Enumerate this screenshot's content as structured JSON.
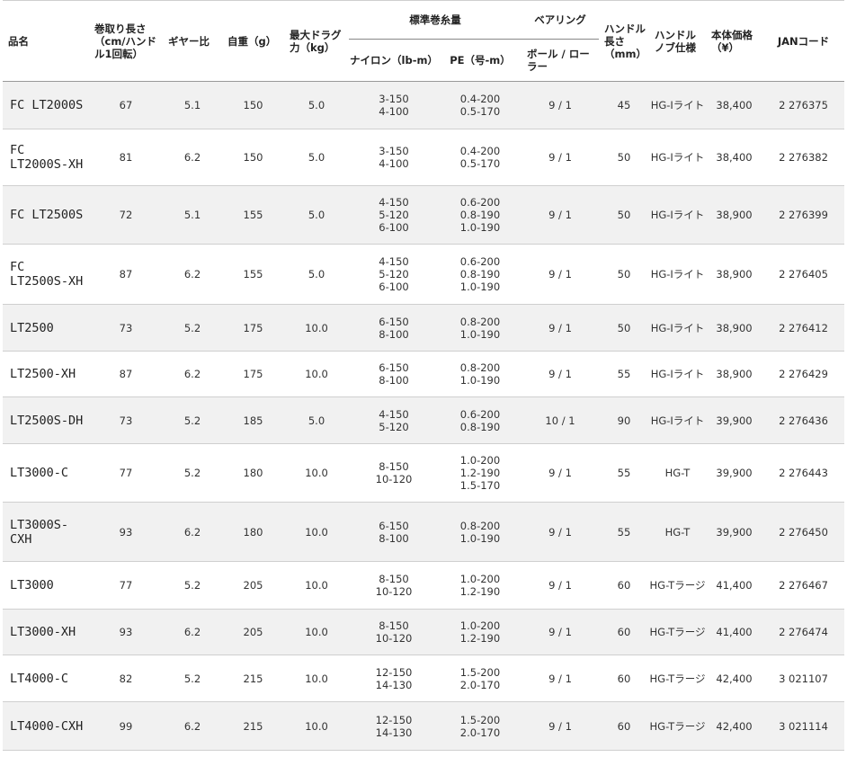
{
  "headers": {
    "name": "品名",
    "retrieve": "巻取り長さ（cm/ハンドル1回転）",
    "gear": "ギヤー比",
    "weight": "自重（g）",
    "drag": "最大ドラグ力（kg）",
    "line_cap": "標準巻糸量",
    "nylon": "ナイロン（lb-m）",
    "pe": "PE（号-m）",
    "bearing": "ベアリング",
    "bearing_sub": "ボール / ローラー",
    "handle_len": "ハンドル長さ（mm）",
    "knob": "ハンドルノブ仕様",
    "price": "本体価格（¥）",
    "jan": "JANコード"
  },
  "rows": [
    {
      "name": "FC LT2000S",
      "retrieve": "67",
      "gear": "5.1",
      "weight": "150",
      "drag": "5.0",
      "nylon": [
        "3-150",
        "4-100"
      ],
      "pe": [
        "0.4-200",
        "0.5-170"
      ],
      "bearing": "9 / 1",
      "handle": "45",
      "knob": "HG-Iライト",
      "price": "38,400",
      "jan": "2 276375"
    },
    {
      "name": "FC LT2000S-XH",
      "retrieve": "81",
      "gear": "6.2",
      "weight": "150",
      "drag": "5.0",
      "nylon": [
        "3-150",
        "4-100"
      ],
      "pe": [
        "0.4-200",
        "0.5-170"
      ],
      "bearing": "9 / 1",
      "handle": "50",
      "knob": "HG-Iライト",
      "price": "38,400",
      "jan": "2 276382"
    },
    {
      "name": "FC LT2500S",
      "retrieve": "72",
      "gear": "5.1",
      "weight": "155",
      "drag": "5.0",
      "nylon": [
        "4-150",
        "5-120",
        "6-100"
      ],
      "pe": [
        "0.6-200",
        "0.8-190",
        "1.0-190"
      ],
      "bearing": "9 / 1",
      "handle": "50",
      "knob": "HG-Iライト",
      "price": "38,900",
      "jan": "2 276399"
    },
    {
      "name": "FC LT2500S-XH",
      "retrieve": "87",
      "gear": "6.2",
      "weight": "155",
      "drag": "5.0",
      "nylon": [
        "4-150",
        "5-120",
        "6-100"
      ],
      "pe": [
        "0.6-200",
        "0.8-190",
        "1.0-190"
      ],
      "bearing": "9 / 1",
      "handle": "50",
      "knob": "HG-Iライト",
      "price": "38,900",
      "jan": "2 276405"
    },
    {
      "name": "LT2500",
      "retrieve": "73",
      "gear": "5.2",
      "weight": "175",
      "drag": "10.0",
      "nylon": [
        "6-150",
        "8-100"
      ],
      "pe": [
        "0.8-200",
        "1.0-190"
      ],
      "bearing": "9 / 1",
      "handle": "50",
      "knob": "HG-Iライト",
      "price": "38,900",
      "jan": "2 276412"
    },
    {
      "name": "LT2500-XH",
      "retrieve": "87",
      "gear": "6.2",
      "weight": "175",
      "drag": "10.0",
      "nylon": [
        "6-150",
        "8-100"
      ],
      "pe": [
        "0.8-200",
        "1.0-190"
      ],
      "bearing": "9 / 1",
      "handle": "55",
      "knob": "HG-Iライト",
      "price": "38,900",
      "jan": "2 276429"
    },
    {
      "name": "LT2500S-DH",
      "retrieve": "73",
      "gear": "5.2",
      "weight": "185",
      "drag": "5.0",
      "nylon": [
        "4-150",
        "5-120"
      ],
      "pe": [
        "0.6-200",
        "0.8-190"
      ],
      "bearing": "10 / 1",
      "handle": "90",
      "knob": "HG-Iライト",
      "price": "39,900",
      "jan": "2 276436"
    },
    {
      "name": "LT3000-C",
      "retrieve": "77",
      "gear": "5.2",
      "weight": "180",
      "drag": "10.0",
      "nylon": [
        "8-150",
        "10-120"
      ],
      "pe": [
        "1.0-200",
        "1.2-190",
        "1.5-170"
      ],
      "bearing": "9 / 1",
      "handle": "55",
      "knob": "HG-T",
      "price": "39,900",
      "jan": "2 276443"
    },
    {
      "name": "LT3000S-CXH",
      "retrieve": "93",
      "gear": "6.2",
      "weight": "180",
      "drag": "10.0",
      "nylon": [
        "6-150",
        "8-100"
      ],
      "pe": [
        "0.8-200",
        "1.0-190"
      ],
      "bearing": "9 / 1",
      "handle": "55",
      "knob": "HG-T",
      "price": "39,900",
      "jan": "2 276450"
    },
    {
      "name": "LT3000",
      "retrieve": "77",
      "gear": "5.2",
      "weight": "205",
      "drag": "10.0",
      "nylon": [
        "8-150",
        "10-120"
      ],
      "pe": [
        "1.0-200",
        "1.2-190"
      ],
      "bearing": "9 / 1",
      "handle": "60",
      "knob": "HG-Tラージ",
      "price": "41,400",
      "jan": "2 276467"
    },
    {
      "name": "LT3000-XH",
      "retrieve": "93",
      "gear": "6.2",
      "weight": "205",
      "drag": "10.0",
      "nylon": [
        "8-150",
        "10-120"
      ],
      "pe": [
        "1.0-200",
        "1.2-190"
      ],
      "bearing": "9 / 1",
      "handle": "60",
      "knob": "HG-Tラージ",
      "price": "41,400",
      "jan": "2 276474"
    },
    {
      "name": "LT4000-C",
      "retrieve": "82",
      "gear": "5.2",
      "weight": "215",
      "drag": "10.0",
      "nylon": [
        "12-150",
        "14-130"
      ],
      "pe": [
        "1.5-200",
        "2.0-170"
      ],
      "bearing": "9 / 1",
      "handle": "60",
      "knob": "HG-Tラージ",
      "price": "42,400",
      "jan": "3 021107"
    },
    {
      "name": "LT4000-CXH",
      "retrieve": "99",
      "gear": "6.2",
      "weight": "215",
      "drag": "10.0",
      "nylon": [
        "12-150",
        "14-130"
      ],
      "pe": [
        "1.5-200",
        "2.0-170"
      ],
      "bearing": "9 / 1",
      "handle": "60",
      "knob": "HG-Tラージ",
      "price": "42,400",
      "jan": "3 021114"
    }
  ]
}
